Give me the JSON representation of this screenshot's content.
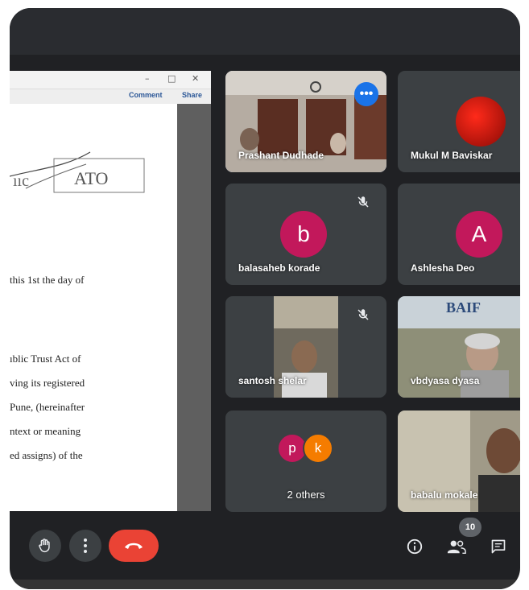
{
  "document": {
    "comment_label": "Comment",
    "share_label": "Share",
    "seal_text": "ATO",
    "lines": [
      "this 1st the day of",
      "ıblic Trust Act of",
      "ving its registered",
      "Pune, (hereinafter",
      "ntext or meaning",
      "ed assigns) of the"
    ]
  },
  "participants": [
    {
      "name": "Prashant Dudhade",
      "type": "video"
    },
    {
      "name": "Mukul M Baviskar",
      "type": "avatar-image"
    },
    {
      "name": "balasaheb korade",
      "type": "letter",
      "letter": "b",
      "color": "#c2185b",
      "muted": true
    },
    {
      "name": "Ashlesha Deo",
      "type": "letter",
      "letter": "A",
      "color": "#c2185b"
    },
    {
      "name": "santosh shelar",
      "type": "video",
      "muted": true
    },
    {
      "name": "vbdyasa dyasa",
      "type": "video"
    },
    {
      "name": "2 others",
      "type": "group",
      "letters": [
        "p",
        "k"
      ]
    },
    {
      "name": "babalu mokale",
      "type": "video"
    }
  ],
  "participant_count": "10",
  "controls": [
    "raise-hand",
    "more-options",
    "end-call",
    "meeting-details",
    "people",
    "chat"
  ],
  "colors": {
    "background": "#202124",
    "tile": "#3c4043",
    "end_call": "#ea4335",
    "active_speaker": "#8ab4f8"
  }
}
